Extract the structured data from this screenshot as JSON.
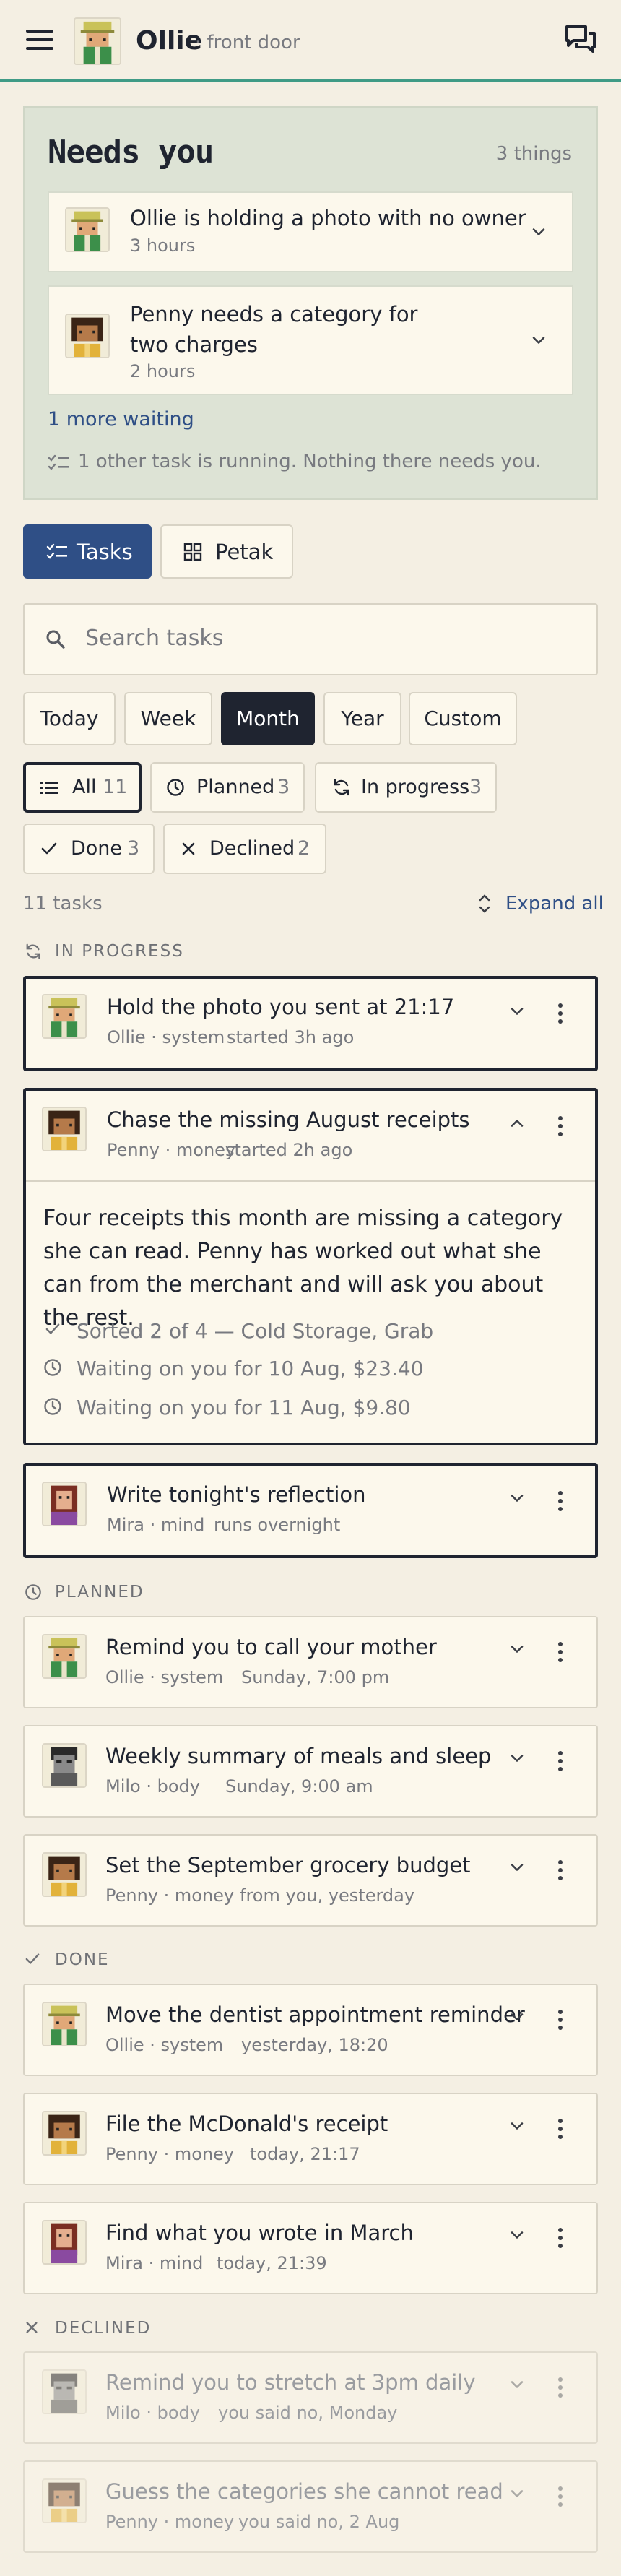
{
  "header": {
    "name": "Ollie",
    "location": "· front door"
  },
  "needs_you": {
    "title": "Needs you",
    "count": "3 things",
    "items": [
      {
        "text": "Ollie is holding a photo with no owner",
        "age": "3 hours"
      },
      {
        "text": "Penny needs a category for two charges",
        "age": "2 hours"
      }
    ],
    "more": "1 more waiting",
    "running": "1 other task is running. Nothing there needs you."
  },
  "view_tabs": [
    {
      "label": "Tasks"
    },
    {
      "label": "Petak"
    }
  ],
  "search": {
    "placeholder": "Search tasks"
  },
  "ranges": [
    "Today",
    "Week",
    "Month",
    "Year",
    "Custom"
  ],
  "selected_range": "Month",
  "filters": [
    {
      "label": "All",
      "count": "11"
    },
    {
      "label": "Planned",
      "count": "3"
    },
    {
      "label": "In progress",
      "count": "3"
    },
    {
      "label": "Done",
      "count": "3"
    },
    {
      "label": "Declined",
      "count": "2"
    }
  ],
  "summary": {
    "count": "11 tasks",
    "expand": "Expand all"
  },
  "sections": {
    "in_progress": "IN PROGRESS",
    "planned": "PLANNED",
    "done": "DONE",
    "declined": "DECLINED"
  },
  "tasks": [
    {
      "title": "Hold the photo you sent at 21:17",
      "agent": "Ollie · system",
      "when": "started 3h ago"
    },
    {
      "title": "Chase the missing August receipts",
      "agent": "Penny · money",
      "when": "started 2h ago",
      "detail": "Four receipts this month are missing a category she can read. Penny has worked out what she can from the merchant and will ask you about the rest.",
      "steps": [
        "Sorted 2 of 4 — Cold Storage, Grab",
        "Waiting on you for 10 Aug, $23.40",
        "Waiting on you for 11 Aug, $9.80"
      ]
    },
    {
      "title": "Write tonight's reflection",
      "agent": "Mira · mind",
      "when": "runs overnight"
    },
    {
      "title": "Remind you to call your mother",
      "agent": "Ollie · system",
      "when": "Sunday, 7:00 pm"
    },
    {
      "title": "Weekly summary of meals and sleep",
      "agent": "Milo · body",
      "when": "Sunday, 9:00 am"
    },
    {
      "title": "Set the September grocery budget",
      "agent": "Penny · money",
      "when": "from you, yesterday"
    },
    {
      "title": "Move the dentist appointment reminder",
      "agent": "Ollie · system",
      "when": "yesterday, 18:20"
    },
    {
      "title": "File the McDonald's receipt",
      "agent": "Penny · money",
      "when": "today, 21:17"
    },
    {
      "title": "Find what you wrote in March",
      "agent": "Mira · mind",
      "when": "today, 21:39"
    },
    {
      "title": "Remind you to stretch at 3pm daily",
      "agent": "Milo · body",
      "when": "you said no, Monday"
    },
    {
      "title": "Guess the categories she cannot read",
      "agent": "Penny · money",
      "when": "you said no, 2 Aug"
    }
  ],
  "colors": {
    "background": "#f4efe3",
    "accent_line": "#3f9b86",
    "primary_blue": "#2f4f86",
    "dark": "#1f2430",
    "panel_green": "#dde3d5"
  }
}
